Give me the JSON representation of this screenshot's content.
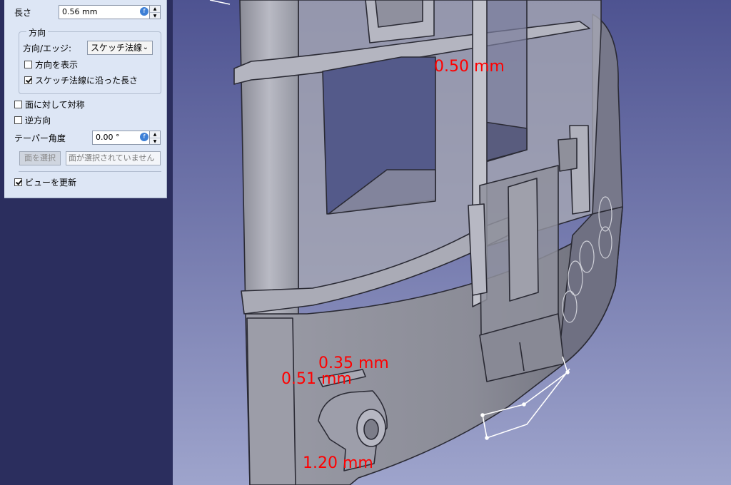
{
  "task_panel": {
    "length_label": "長さ",
    "length_value": "0.56 mm",
    "direction_group_title": "方向",
    "direction_edge_label": "方向/エッジ:",
    "direction_edge_value": "スケッチ法線",
    "show_direction_label": "方向を表示",
    "show_direction_checked": false,
    "along_normal_label": "スケッチ法線に沿った長さ",
    "along_normal_checked": true,
    "symmetric_label": "面に対して対称",
    "symmetric_checked": false,
    "reversed_label": "逆方向",
    "reversed_checked": false,
    "taper_label": "テーパー角度",
    "taper_value": "0.00 °",
    "select_face_button": "面を選択",
    "face_status": "面が選択されていません",
    "update_view_label": "ビューを更新",
    "update_view_checked": true
  },
  "dimensions": {
    "d1": "0.50 mm",
    "d2": "0.35 mm",
    "d3": "0.51 mm",
    "d4": "1.20 mm"
  },
  "colors": {
    "viewport_top": "#4e5391",
    "viewport_bottom": "#9ea4cc",
    "dimension_text": "#ff0000",
    "panel_bg": "#dde6f5"
  }
}
